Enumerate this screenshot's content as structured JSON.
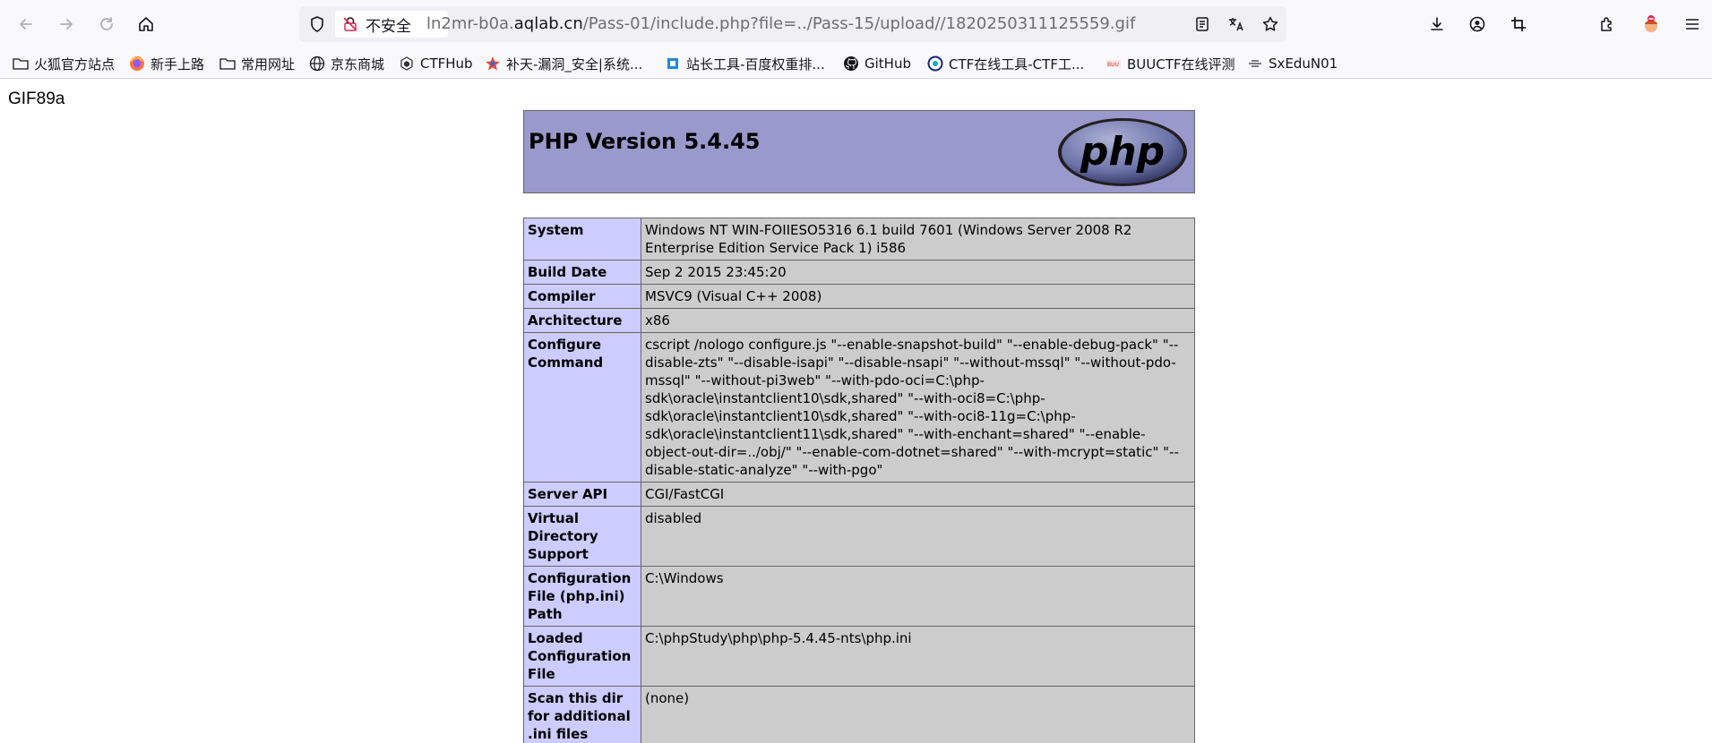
{
  "browser": {
    "security_label": "不安全",
    "url_domain_prefix": "ln2mr-b0a.",
    "url_domain": "aqlab.cn",
    "url_path": "/Pass-01/include.php?file=../Pass-15/upload//1820250311125559.gif"
  },
  "bookmarks": [
    {
      "label": "火狐官方站点",
      "icon": "folder-icon"
    },
    {
      "label": "新手上路",
      "icon": "firefox-icon"
    },
    {
      "label": "常用网址",
      "icon": "folder-icon"
    },
    {
      "label": "京东商城",
      "icon": "globe-icon"
    },
    {
      "label": "CTFHub",
      "icon": "ctfhub-icon"
    },
    {
      "label": "补天-漏洞_安全|系统...",
      "icon": "butian-icon"
    },
    {
      "label": "站长工具-百度权重排...",
      "icon": "chinaz-icon"
    },
    {
      "label": "GitHub",
      "icon": "github-icon"
    },
    {
      "label": "CTF在线工具-CTF工...",
      "icon": "ctftool-icon"
    },
    {
      "label": "BUUCTF在线评测",
      "icon": "buuctf-icon"
    },
    {
      "label": "SxEduN01",
      "icon": "sxedu-icon"
    }
  ],
  "page": {
    "gif_header": "GIF89a",
    "php_version": "PHP Version 5.4.45",
    "logo_text": "php",
    "rows": [
      {
        "key": "System",
        "value": "Windows NT WIN-FOIIESO5316 6.1 build 7601 (Windows Server 2008 R2 Enterprise Edition Service Pack 1) i586"
      },
      {
        "key": "Build Date",
        "value": "Sep 2 2015 23:45:20"
      },
      {
        "key": "Compiler",
        "value": "MSVC9 (Visual C++ 2008)"
      },
      {
        "key": "Architecture",
        "value": "x86"
      },
      {
        "key": "Configure Command",
        "value": "cscript /nologo configure.js \"--enable-snapshot-build\" \"--enable-debug-pack\" \"--disable-zts\" \"--disable-isapi\" \"--disable-nsapi\" \"--without-mssql\" \"--without-pdo-mssql\" \"--without-pi3web\" \"--with-pdo-oci=C:\\php-sdk\\oracle\\instantclient10\\sdk,shared\" \"--with-oci8=C:\\php-sdk\\oracle\\instantclient10\\sdk,shared\" \"--with-oci8-11g=C:\\php-sdk\\oracle\\instantclient11\\sdk,shared\" \"--with-enchant=shared\" \"--enable-object-out-dir=../obj/\" \"--enable-com-dotnet=shared\" \"--with-mcrypt=static\" \"--disable-static-analyze\" \"--with-pgo\""
      },
      {
        "key": "Server API",
        "value": "CGI/FastCGI"
      },
      {
        "key": "Virtual Directory Support",
        "value": "disabled"
      },
      {
        "key": "Configuration File (php.ini) Path",
        "value": "C:\\Windows"
      },
      {
        "key": "Loaded Configuration File",
        "value": "C:\\phpStudy\\php\\php-5.4.45-nts\\php.ini"
      },
      {
        "key": "Scan this dir for additional .ini files",
        "value": "(none)"
      }
    ]
  },
  "colors": {
    "header_bg": "#9999cc",
    "key_bg": "#ccccff",
    "value_bg": "#cccccc"
  }
}
